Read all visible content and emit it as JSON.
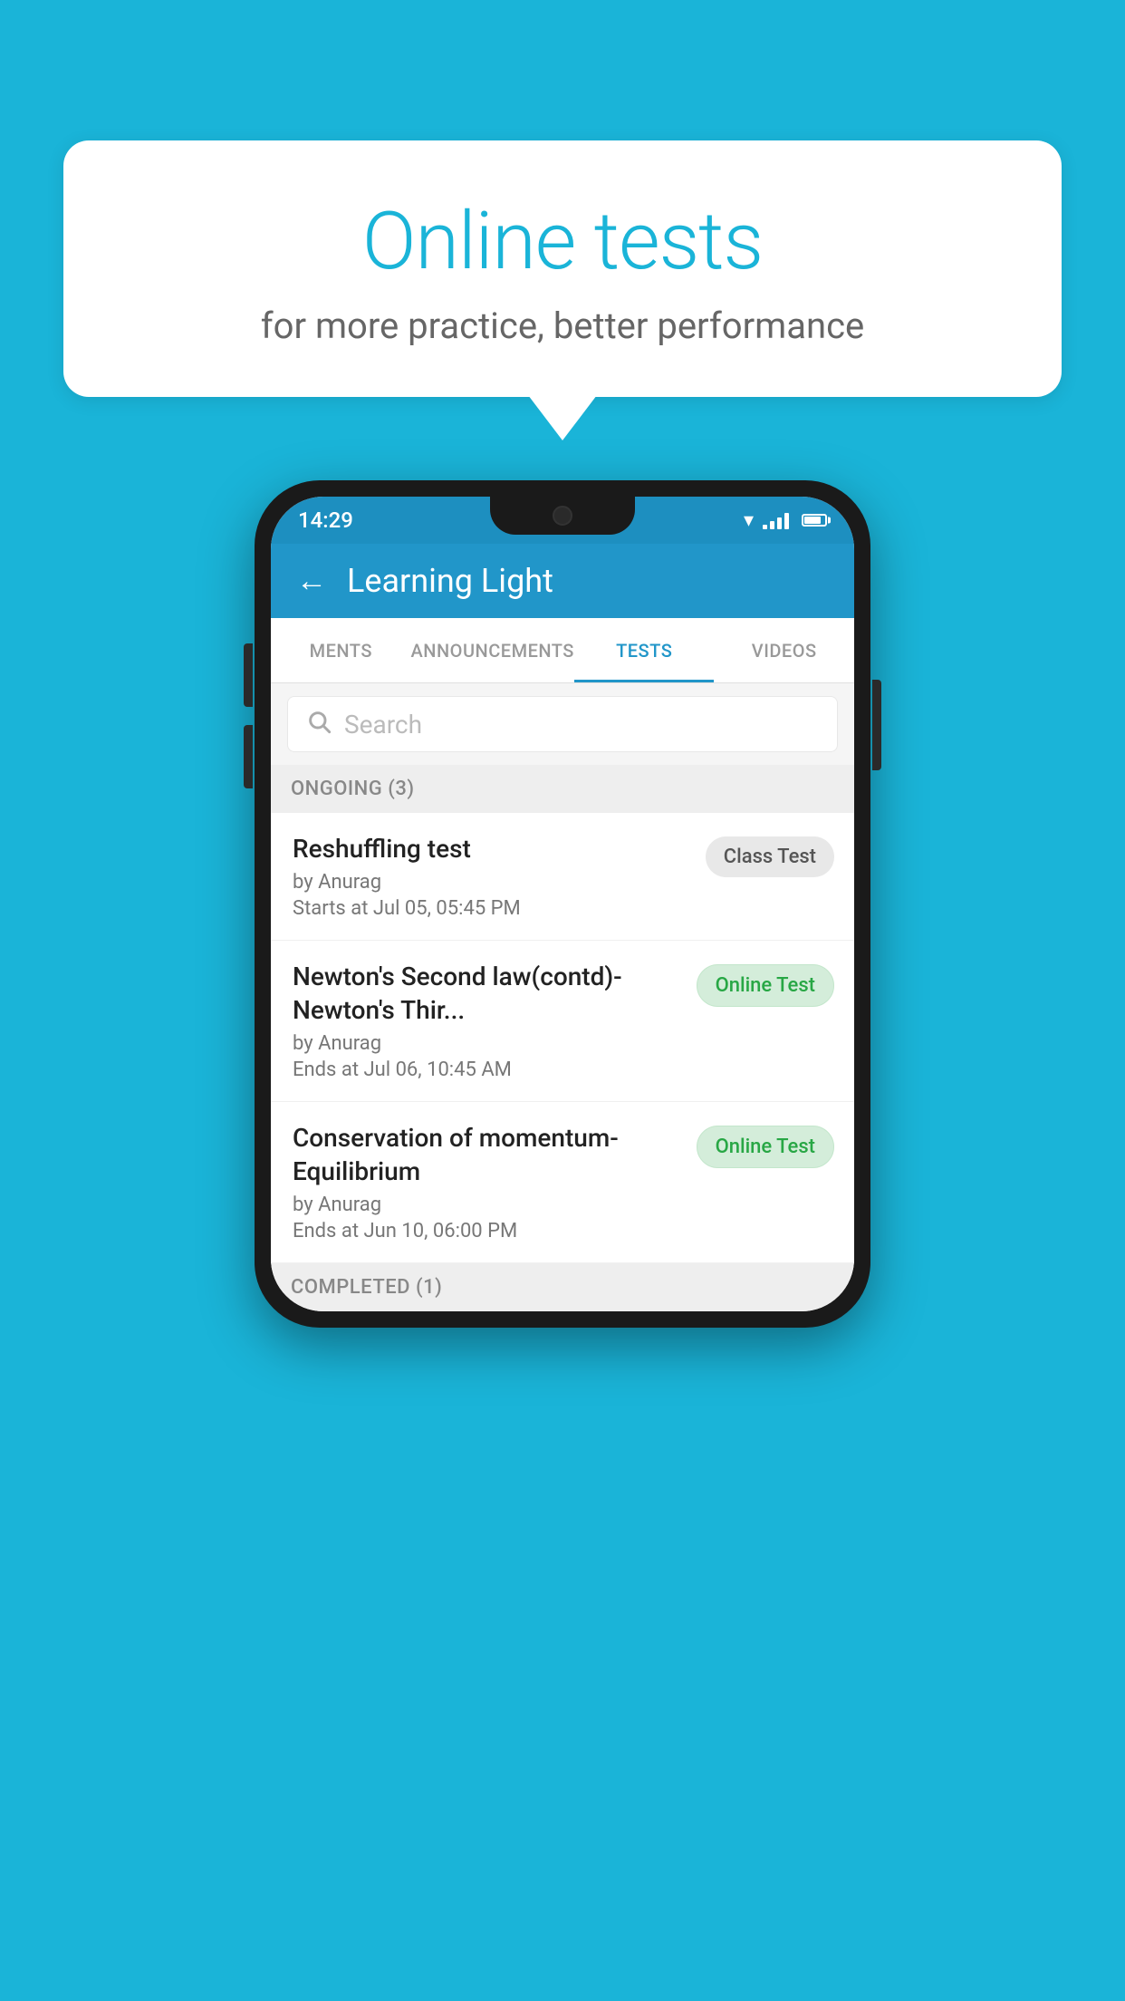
{
  "background_color": "#1ab4d8",
  "speech_bubble": {
    "title": "Online tests",
    "subtitle": "for more practice, better performance"
  },
  "phone": {
    "status_bar": {
      "time": "14:29",
      "wifi": true,
      "signal": true,
      "battery": true
    },
    "header": {
      "title": "Learning Light",
      "back_label": "←"
    },
    "tabs": [
      {
        "label": "MENTS",
        "active": false
      },
      {
        "label": "ANNOUNCEMENTS",
        "active": false
      },
      {
        "label": "TESTS",
        "active": true
      },
      {
        "label": "VIDEOS",
        "active": false
      }
    ],
    "search": {
      "placeholder": "Search"
    },
    "sections": [
      {
        "title": "ONGOING (3)",
        "items": [
          {
            "name": "Reshuffling test",
            "author": "by Anurag",
            "time": "Starts at  Jul 05, 05:45 PM",
            "badge": "Class Test",
            "badge_type": "class"
          },
          {
            "name": "Newton's Second law(contd)-Newton's Thir...",
            "author": "by Anurag",
            "time": "Ends at  Jul 06, 10:45 AM",
            "badge": "Online Test",
            "badge_type": "online"
          },
          {
            "name": "Conservation of momentum-Equilibrium",
            "author": "by Anurag",
            "time": "Ends at  Jun 10, 06:00 PM",
            "badge": "Online Test",
            "badge_type": "online"
          }
        ]
      },
      {
        "title": "COMPLETED (1)",
        "items": []
      }
    ]
  }
}
